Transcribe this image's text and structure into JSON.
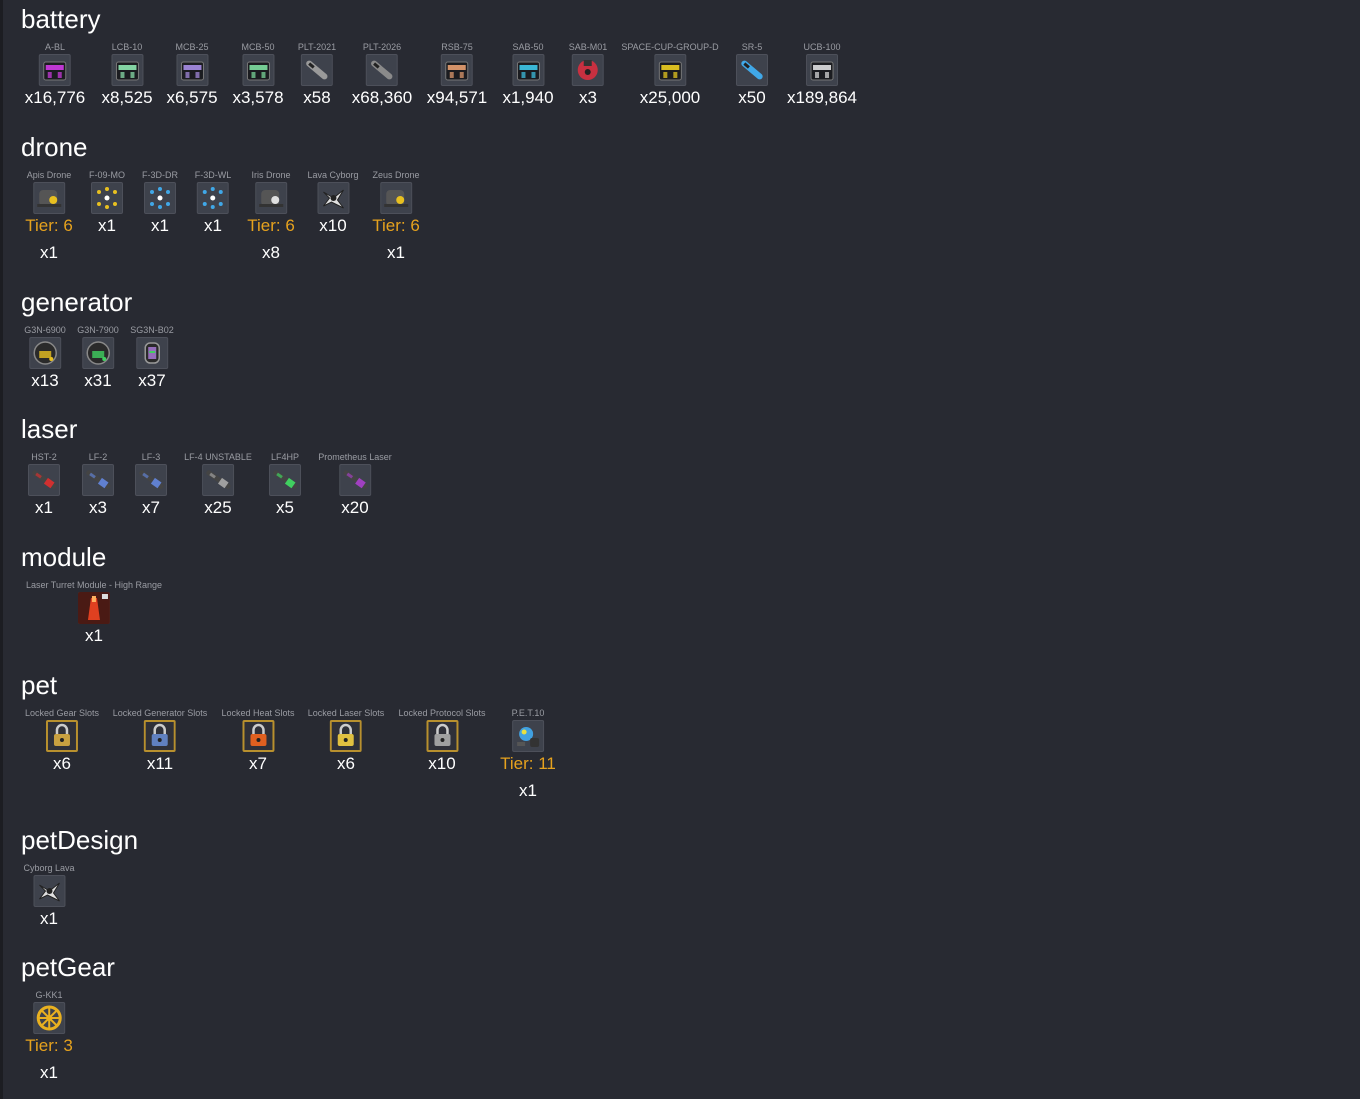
{
  "sections": [
    {
      "title": "battery",
      "items": [
        {
          "name": "A-BL",
          "qty": "x16,776",
          "icon": "battery-crate-magenta-icon",
          "color": "#d23ce6"
        },
        {
          "name": "LCB-10",
          "qty": "x8,525",
          "icon": "battery-crate-green-icon",
          "color": "#8fe8b0"
        },
        {
          "name": "MCB-25",
          "qty": "x6,575",
          "icon": "battery-crate-violet-icon",
          "color": "#a98ee6"
        },
        {
          "name": "MCB-50",
          "qty": "x3,578",
          "icon": "battery-crate-mint-icon",
          "color": "#7fe0a0"
        },
        {
          "name": "PLT-2021",
          "qty": "x58",
          "icon": "rocket-icon",
          "color": "#9a9a9a"
        },
        {
          "name": "PLT-2026",
          "qty": "x68,360",
          "icon": "rocket-icon",
          "color": "#8a8a8a"
        },
        {
          "name": "RSB-75",
          "qty": "x94,571",
          "icon": "battery-crate-orange-icon",
          "color": "#e8a070"
        },
        {
          "name": "SAB-50",
          "qty": "x1,940",
          "icon": "battery-crate-cyan-icon",
          "color": "#3ec8e8"
        },
        {
          "name": "SAB-M01",
          "qty": "x3",
          "icon": "battery-red-icon",
          "color": "#c83040"
        },
        {
          "name": "SPACE-CUP-GROUP-D",
          "qty": "x25,000",
          "icon": "cup-crate-yellow-icon",
          "color": "#f0d020"
        },
        {
          "name": "SR-5",
          "qty": "x50",
          "icon": "rocket-blue-icon",
          "color": "#40a8e8"
        },
        {
          "name": "UCB-100",
          "qty": "x189,864",
          "icon": "battery-crate-white-icon",
          "color": "#e0e0e0"
        }
      ]
    },
    {
      "title": "drone",
      "items": [
        {
          "name": "Apis Drone",
          "tier": "Tier: 6",
          "qty": "x1",
          "icon": "drone-icon",
          "color": "#e8c020"
        },
        {
          "name": "F-09-MO",
          "qty": "x1",
          "icon": "formation-icon",
          "color": "#e8c020"
        },
        {
          "name": "F-3D-DR",
          "qty": "x1",
          "icon": "formation-icon",
          "color": "#40a8e8"
        },
        {
          "name": "F-3D-WL",
          "qty": "x1",
          "icon": "formation-icon",
          "color": "#40a8e8"
        },
        {
          "name": "Iris Drone",
          "tier": "Tier: 6",
          "qty": "x8",
          "icon": "drone-icon",
          "color": "#e0e0e0"
        },
        {
          "name": "Lava Cyborg",
          "qty": "x10",
          "icon": "cyborg-icon",
          "color": "#e0e0e0"
        },
        {
          "name": "Zeus Drone",
          "tier": "Tier: 6",
          "qty": "x1",
          "icon": "drone-icon",
          "color": "#e8c020"
        }
      ]
    },
    {
      "title": "generator",
      "items": [
        {
          "name": "G3N-6900",
          "qty": "x13",
          "icon": "generator-icon",
          "color": "#e8c020"
        },
        {
          "name": "G3N-7900",
          "qty": "x31",
          "icon": "generator-icon",
          "color": "#40d060"
        },
        {
          "name": "SG3N-B02",
          "qty": "x37",
          "icon": "shield-generator-icon",
          "color": "#b080e0"
        }
      ]
    },
    {
      "title": "laser",
      "items": [
        {
          "name": "HST-2",
          "qty": "x1",
          "icon": "laser-cannon-icon",
          "color": "#d03030"
        },
        {
          "name": "LF-2",
          "qty": "x3",
          "icon": "laser-cannon-icon",
          "color": "#6080d0"
        },
        {
          "name": "LF-3",
          "qty": "x7",
          "icon": "laser-cannon-icon",
          "color": "#6080d0"
        },
        {
          "name": "LF-4 UNSTABLE",
          "qty": "x25",
          "icon": "laser-cannon-icon",
          "color": "#a0a0a0"
        },
        {
          "name": "LF4HP",
          "qty": "x5",
          "icon": "laser-cannon-icon",
          "color": "#40d060"
        },
        {
          "name": "Prometheus Laser",
          "qty": "x20",
          "icon": "laser-cannon-icon",
          "color": "#a040c0"
        }
      ]
    },
    {
      "title": "module",
      "items": [
        {
          "name": "Laser Turret Module - High Range",
          "qty": "x1",
          "icon": "turret-module-icon",
          "color": "#e04020"
        }
      ]
    },
    {
      "title": "pet",
      "items": [
        {
          "name": "Locked Gear Slots",
          "qty": "x6",
          "icon": "padlock-icon",
          "color": "#c8a040"
        },
        {
          "name": "Locked Generator Slots",
          "qty": "x11",
          "icon": "padlock-icon",
          "color": "#6080c0"
        },
        {
          "name": "Locked Heat Slots",
          "qty": "x7",
          "icon": "padlock-icon",
          "color": "#e06020"
        },
        {
          "name": "Locked Laser Slots",
          "qty": "x6",
          "icon": "padlock-icon",
          "color": "#e0c040"
        },
        {
          "name": "Locked Protocol Slots",
          "qty": "x10",
          "icon": "padlock-icon",
          "color": "#a0a0a0"
        },
        {
          "name": "P.E.T.10",
          "tier": "Tier: 11",
          "qty": "x1",
          "icon": "pet-robot-icon",
          "color": "#40a0e0"
        }
      ]
    },
    {
      "title": "petDesign",
      "items": [
        {
          "name": "Cyborg Lava",
          "qty": "x1",
          "icon": "cyborg-icon",
          "color": "#e0e0e0"
        }
      ]
    },
    {
      "title": "petGear",
      "items": [
        {
          "name": "G-KK1",
          "tier": "Tier: 3",
          "qty": "x1",
          "icon": "gear-wheel-icon",
          "color": "#e8b020"
        }
      ]
    }
  ]
}
